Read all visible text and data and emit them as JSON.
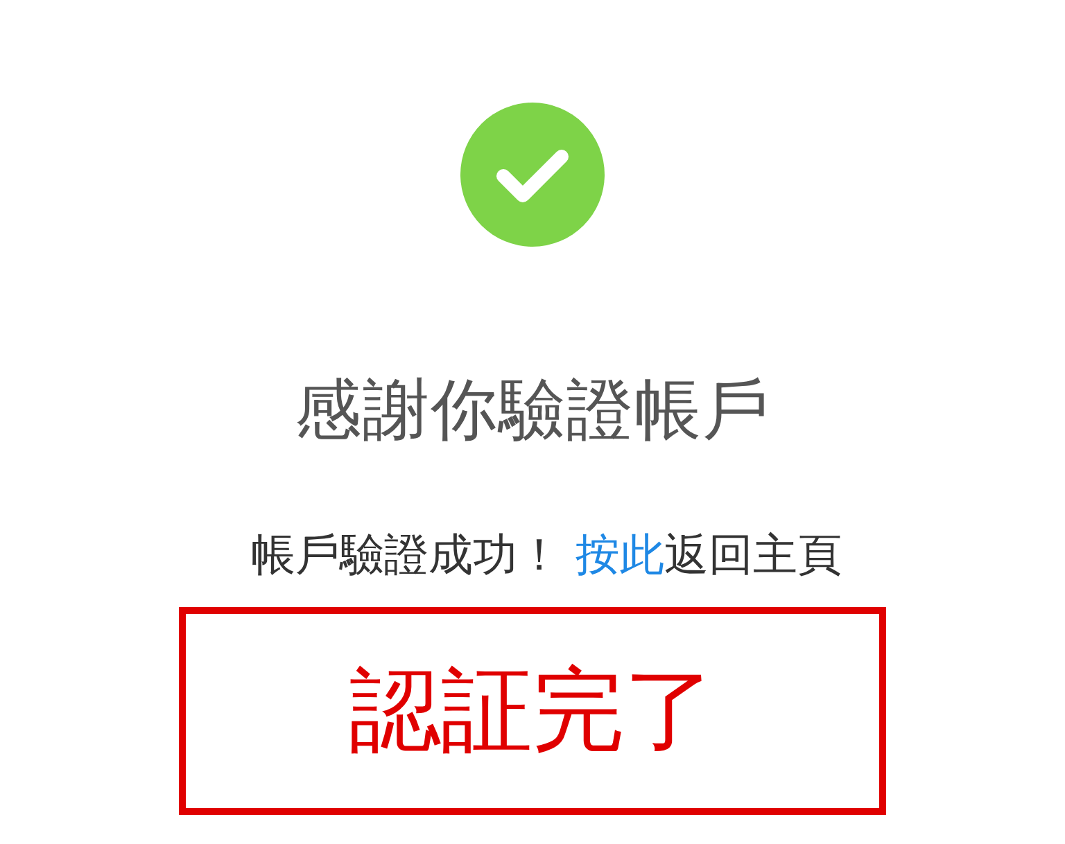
{
  "status": {
    "kind": "success"
  },
  "title": "感謝你驗證帳戶",
  "message": {
    "before": "帳戶驗證成功！ ",
    "link": "按此",
    "after": "返回主頁"
  },
  "annotation": {
    "text": "認証完了",
    "color": "#e00000"
  }
}
